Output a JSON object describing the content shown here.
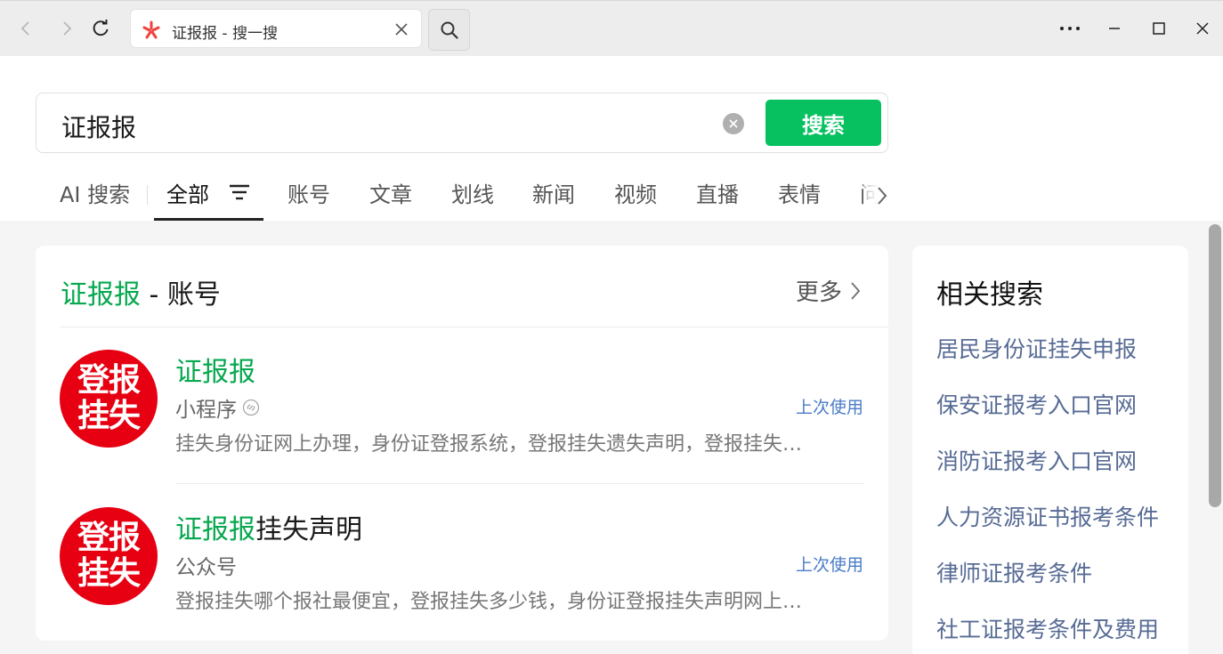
{
  "browser": {
    "tab_title": "证报报 - 搜一搜"
  },
  "search": {
    "query": "证报报",
    "button_label": "搜索"
  },
  "tabs": [
    {
      "label": "AI 搜索",
      "active": false
    },
    {
      "label": "全部",
      "active": true
    },
    {
      "label": "账号",
      "active": false
    },
    {
      "label": "文章",
      "active": false
    },
    {
      "label": "划线",
      "active": false
    },
    {
      "label": "新闻",
      "active": false
    },
    {
      "label": "视频",
      "active": false
    },
    {
      "label": "直播",
      "active": false
    },
    {
      "label": "表情",
      "active": false
    },
    {
      "label": "问",
      "active": false
    }
  ],
  "accounts_card": {
    "title_highlight": "证报报",
    "title_rest": " - 账号",
    "more_label": "更多",
    "items": [
      {
        "avatar_line1": "登报",
        "avatar_line2": "挂失",
        "title_highlight": "证报报",
        "title_rest": "",
        "type": "小程序",
        "last_used": "上次使用",
        "description": "挂失身份证网上办理，身份证登报系统，登报挂失遗失声明，登报挂失…"
      },
      {
        "avatar_line1": "登报",
        "avatar_line2": "挂失",
        "title_highlight": "证报报",
        "title_rest": "挂失声明",
        "type": "公众号",
        "last_used": "上次使用",
        "description": "登报挂失哪个报社最便宜，登报挂失多少钱，身份证登报挂失声明网上…"
      }
    ]
  },
  "related": {
    "title": "相关搜索",
    "items": [
      "居民身份证挂失申报",
      "保安证报考入口官网",
      "消防证报考入口官网",
      "人力资源证书报考条件",
      "律师证报考条件",
      "社工证报考条件及费用"
    ]
  },
  "colors": {
    "accent_green": "#07c160",
    "highlight_green": "#07a84f",
    "link_blue": "#576b95",
    "badge_red": "#e60012"
  }
}
